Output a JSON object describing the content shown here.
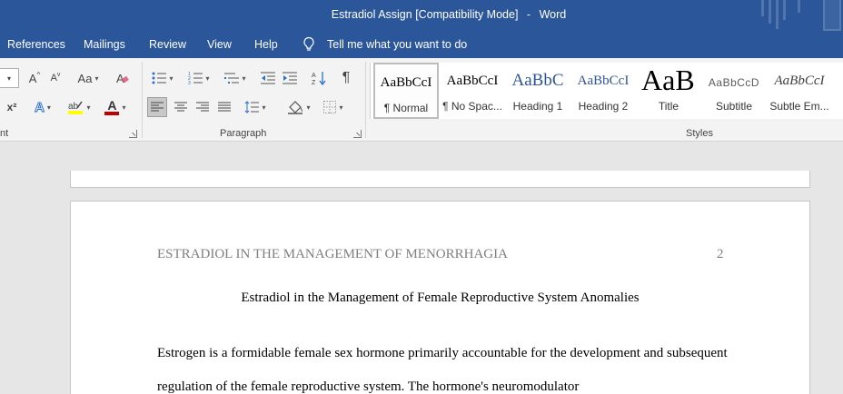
{
  "window": {
    "doc_name": "Estradiol Assign [Compatibility Mode]",
    "separator": "-",
    "app_name": "Word"
  },
  "menu": {
    "items": [
      "References",
      "Mailings",
      "Review",
      "View",
      "Help"
    ],
    "tell_me": "Tell me what you want to do"
  },
  "ribbon": {
    "groups": {
      "font_partial": "nt",
      "paragraph": "Paragraph",
      "styles": "Styles"
    },
    "font": {
      "grow": "A",
      "shrink": "A",
      "change_case": "Aa",
      "superscript": "x²",
      "text_effects": "A",
      "font_color": "A"
    },
    "colors": {
      "highlight": "#ffff00",
      "font_color": "#c00000",
      "accent": "#2b579a"
    }
  },
  "styles": [
    {
      "preview": "AaBbCcI",
      "name": "¶ Normal"
    },
    {
      "preview": "AaBbCcI",
      "name": "¶ No Spac..."
    },
    {
      "preview": "AaBbC",
      "name": "Heading 1"
    },
    {
      "preview": "AaBbCcI",
      "name": "Heading 2"
    },
    {
      "preview": "AaB",
      "name": "Title"
    },
    {
      "preview": "AaBbCcD",
      "name": "Subtitle"
    },
    {
      "preview": "AaBbCcI",
      "name": "Subtle Em..."
    }
  ],
  "document": {
    "running_head": "ESTRADIOL IN THE MANAGEMENT OF MENORRHAGIA",
    "page_number": "2",
    "title": "Estradiol in the Management of Female Reproductive System Anomalies",
    "body": "Estrogen is a formidable female sex hormone primarily accountable for the development and subsequent regulation of the female reproductive system. The hormone's neuromodulator"
  }
}
